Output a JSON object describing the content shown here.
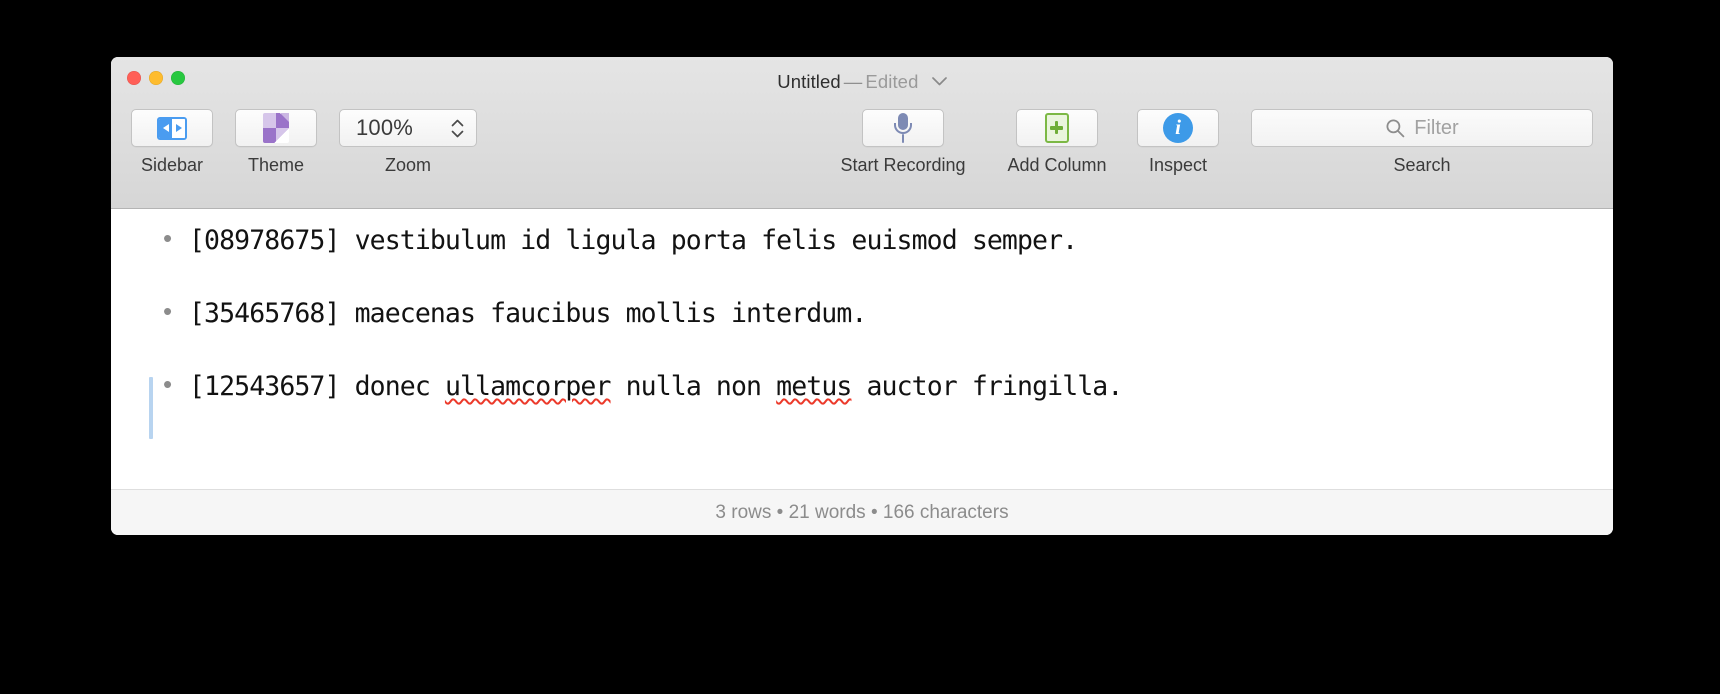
{
  "window": {
    "title_name": "Untitled",
    "title_separator": "—",
    "title_state": "Edited",
    "title_chevron": "chevron-down-icon",
    "traffic_lights": {
      "close": "close-button",
      "minimize": "minimize-button",
      "zoom": "maximize-button"
    },
    "colors": {
      "close": "#ff5f57",
      "minimize": "#febc2e",
      "maximize": "#28c840",
      "toolbar_top": "#e5e5e5",
      "toolbar_bottom": "#d6d6d6",
      "accent_blue": "#4a9cf0",
      "theme_purple": "#9a73c9",
      "add_column_green": "#7cb845",
      "inspect_blue": "#3d9ae8",
      "mic_blue_gray": "#7d8ab4",
      "change_bar_blue": "#b8d4f0",
      "spellcheck_red": "#ec3a2b"
    }
  },
  "toolbar": {
    "items": [
      {
        "label": "Sidebar",
        "icon": "sidebar-toggle-icon"
      },
      {
        "label": "Theme",
        "icon": "theme-page-icon"
      },
      {
        "label": "Zoom",
        "icon": "zoom-stepper",
        "value": "100%"
      },
      {
        "label": "Start Recording",
        "icon": "microphone-icon"
      },
      {
        "label": "Add Column",
        "icon": "add-column-icon"
      },
      {
        "label": "Inspect",
        "icon": "info-circle-icon"
      },
      {
        "label": "Search",
        "icon": "search-icon"
      }
    ]
  },
  "search": {
    "label": "Search",
    "placeholder": "Filter",
    "value": "",
    "icon": "magnifying-glass-icon"
  },
  "document": {
    "lines": [
      {
        "bullet": "•",
        "id": "[08978675]",
        "text": "[08978675] vestibulum id ligula porta felis euismod semper.",
        "changed": false,
        "misspelled": []
      },
      {
        "bullet": "•",
        "id": "[35465768]",
        "text": "[35465768] maecenas faucibus mollis interdum.",
        "changed": false,
        "misspelled": []
      },
      {
        "bullet": "•",
        "id": "[12543657]",
        "text": "[12543657] donec ullamcorper nulla non metus auctor fringilla.",
        "changed": true,
        "misspelled": [
          "ullamcorper",
          "metus"
        ],
        "parts": {
          "pre": "[12543657] donec ",
          "bad1": "ullamcorper",
          "mid": " nulla non ",
          "bad2": "metus",
          "post": " auctor fringilla."
        }
      }
    ]
  },
  "status": {
    "rows": "3 rows",
    "dot1": "•",
    "words": "21 words",
    "dot2": "•",
    "characters": "166 characters",
    "full": "3 rows • 21 words • 166 characters"
  }
}
